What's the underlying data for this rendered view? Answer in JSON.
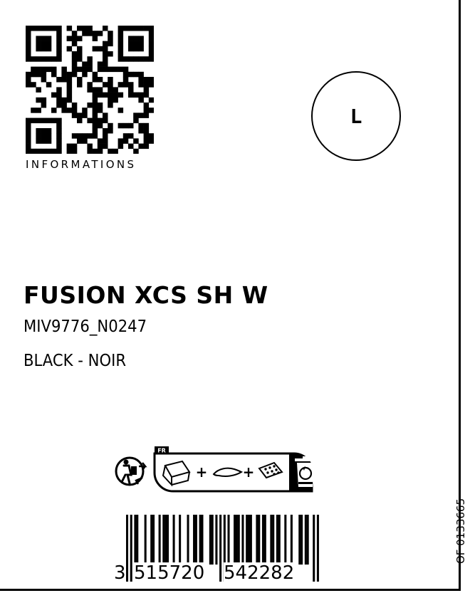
{
  "qr": {
    "label": "INFORMATIONS",
    "icon": "qr-code-icon"
  },
  "size": {
    "value": "L"
  },
  "product": {
    "name": "FUSION XCS SH W",
    "reference": "MIV9776_N0247",
    "color": "BLACK - NOIR"
  },
  "side_code": "OF 0133665",
  "recycling": {
    "country": "FR",
    "icons": [
      "triman-icon",
      "box-icon",
      "plastic-film-icon",
      "bubble-wrap-icon",
      "recycling-bin-icon"
    ],
    "separator": "+"
  },
  "barcode": {
    "first_digit": "3",
    "left_digits": "515720",
    "right_digits": "542282"
  }
}
